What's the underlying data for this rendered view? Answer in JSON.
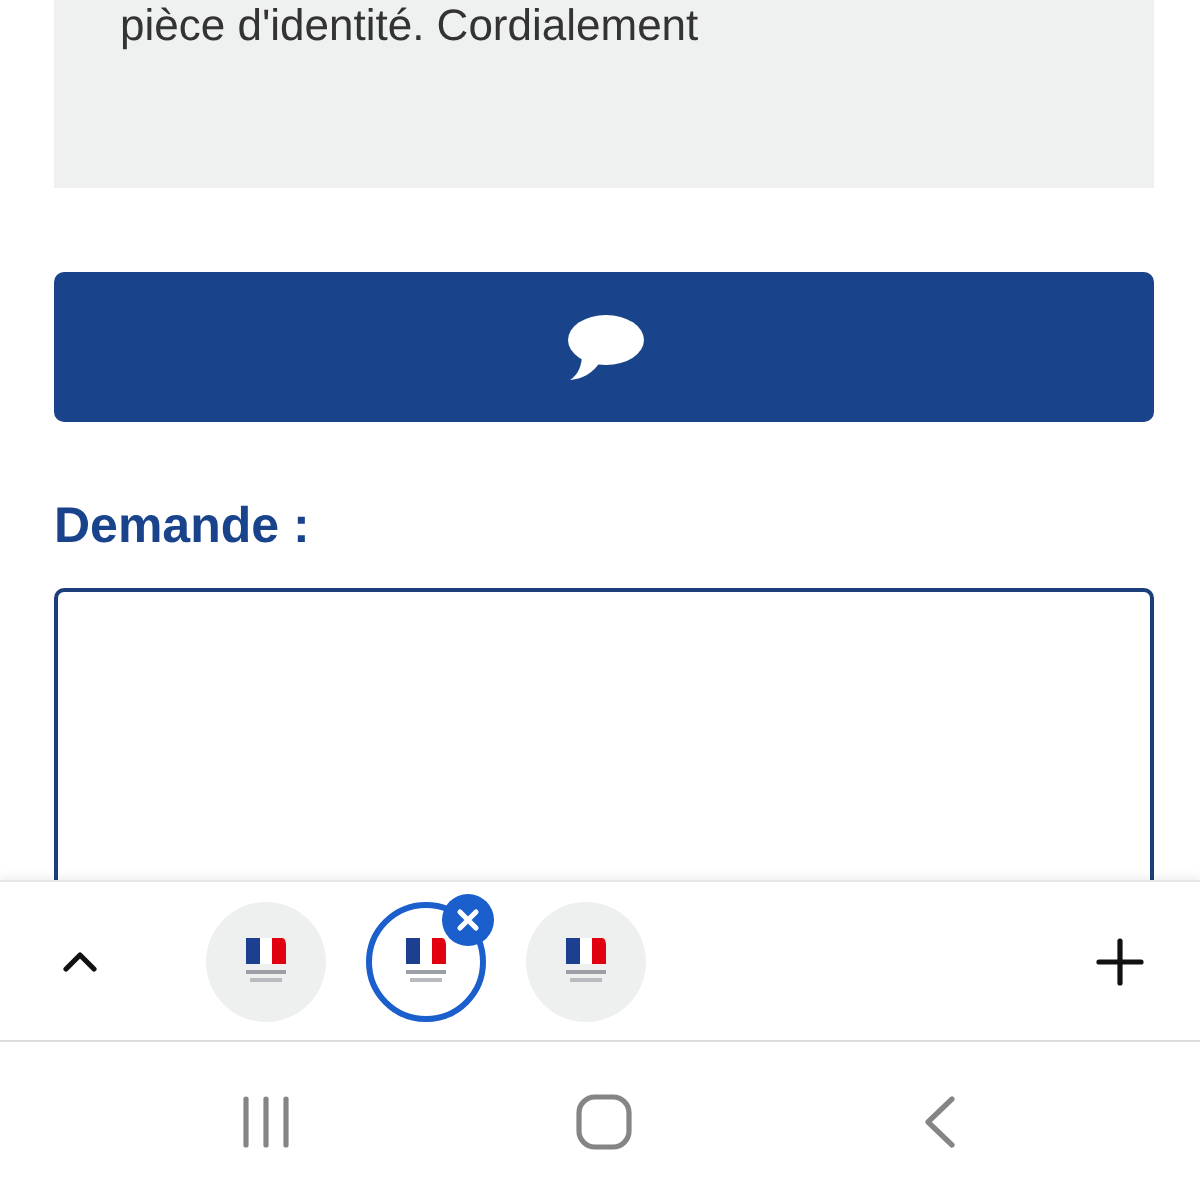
{
  "message": {
    "text": "pièce d'identité. Cordialement"
  },
  "request": {
    "label": "Demande :"
  },
  "tab_switcher": {
    "tabs": [
      {
        "selected": false
      },
      {
        "selected": true
      },
      {
        "selected": false
      }
    ]
  }
}
